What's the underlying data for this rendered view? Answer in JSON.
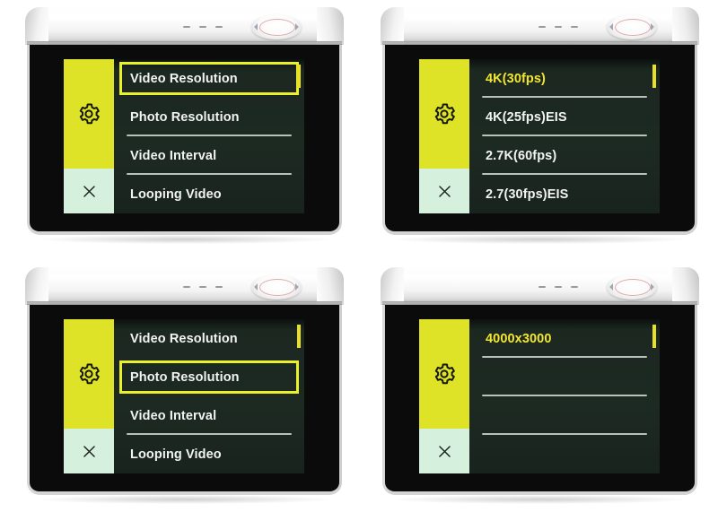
{
  "colors": {
    "accent_yellow": "#eaf02a",
    "rail_yellow": "#dfe327",
    "rail_mint": "#d5f0dc",
    "screen_bg": "#1d2a22",
    "body_black": "#0b0b0b",
    "selected_text": "#f2e633",
    "divider": "#b9c1bb",
    "page_bg": "#ffffff"
  },
  "panels": [
    {
      "id": "settings-menu-video-resolution-focused",
      "position": "top-left",
      "rail": {
        "gear_icon": "gear-icon",
        "close_icon": "close-icon"
      },
      "scroll_indicator": true,
      "rows": [
        {
          "label": "Video Resolution",
          "focused": true,
          "divider": false,
          "selected_text": false
        },
        {
          "label": "Photo Resolution",
          "focused": false,
          "divider": true,
          "selected_text": false
        },
        {
          "label": "Video Interval",
          "focused": false,
          "divider": true,
          "selected_text": false
        },
        {
          "label": "Looping Video",
          "focused": false,
          "divider": false,
          "selected_text": false
        }
      ]
    },
    {
      "id": "video-resolution-options",
      "position": "top-right",
      "rail": {
        "gear_icon": "gear-icon",
        "close_icon": "close-icon"
      },
      "scroll_indicator": true,
      "rows": [
        {
          "label": "4K(30fps)",
          "focused": false,
          "divider": true,
          "selected_text": true
        },
        {
          "label": "4K(25fps)EIS",
          "focused": false,
          "divider": true,
          "selected_text": false
        },
        {
          "label": "2.7K(60fps)",
          "focused": false,
          "divider": true,
          "selected_text": false
        },
        {
          "label": "2.7(30fps)EIS",
          "focused": false,
          "divider": false,
          "selected_text": false
        }
      ]
    },
    {
      "id": "settings-menu-photo-resolution-focused",
      "position": "bottom-left",
      "rail": {
        "gear_icon": "gear-icon",
        "close_icon": "close-icon"
      },
      "scroll_indicator": true,
      "rows": [
        {
          "label": "Video Resolution",
          "focused": false,
          "divider": false,
          "selected_text": false
        },
        {
          "label": "Photo Resolution",
          "focused": true,
          "divider": false,
          "selected_text": false
        },
        {
          "label": "Video Interval",
          "focused": false,
          "divider": true,
          "selected_text": false
        },
        {
          "label": "Looping Video",
          "focused": false,
          "divider": false,
          "selected_text": false
        }
      ]
    },
    {
      "id": "photo-resolution-options",
      "position": "bottom-right",
      "rail": {
        "gear_icon": "gear-icon",
        "close_icon": "close-icon"
      },
      "scroll_indicator": true,
      "rows": [
        {
          "label": "4000x3000",
          "focused": false,
          "divider": true,
          "selected_text": true
        },
        {
          "label": "",
          "focused": false,
          "divider": true,
          "selected_text": false
        },
        {
          "label": "",
          "focused": false,
          "divider": true,
          "selected_text": false
        },
        {
          "label": "",
          "focused": false,
          "divider": false,
          "selected_text": false
        }
      ]
    }
  ]
}
